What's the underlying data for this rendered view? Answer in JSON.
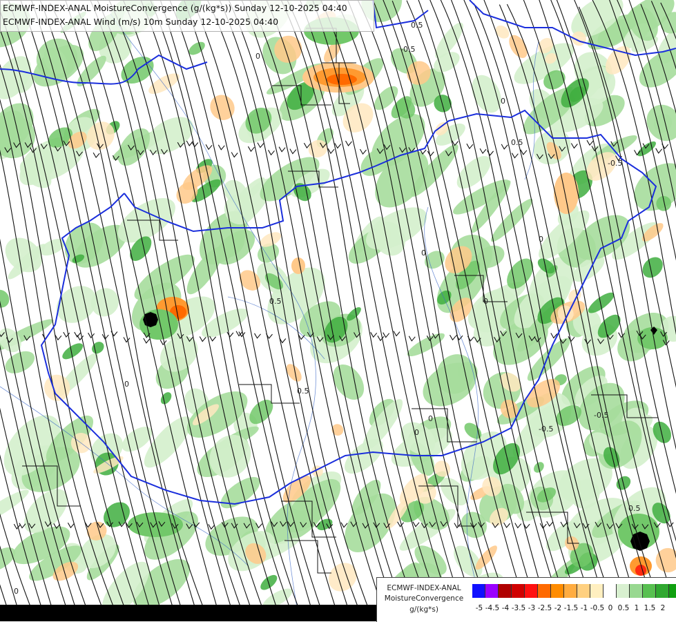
{
  "map": {
    "title_line1": "ECMWF-INDEX-ANAL MoistureConvergence (g/(kg*s)) Sunday 12-10-2025 04:40",
    "title_line2": "ECMWF-INDEX-ANAL Wind (m/s) 10m Sunday 12-10-2025 04:40",
    "contour_labels": [
      "0",
      "-0.5",
      "0.5",
      "0",
      "0",
      "0.5",
      "-0.5",
      "0",
      "0.5",
      "0",
      "-0.5",
      "0",
      "0.5",
      "0",
      "-0.5",
      "0",
      "0",
      "0.5",
      "0"
    ],
    "layers": [
      "moisture-convergence-fill",
      "wind-streamlines",
      "country-borders",
      "rivers"
    ]
  },
  "legend": {
    "title_line1": "ECMWF-INDEX-ANAL",
    "title_line2": "MoistureConvergence",
    "title_line3": "g/(kg*s)",
    "colors": [
      "#1010ff",
      "#9b00ff",
      "#b00000",
      "#d00000",
      "#ff1010",
      "#ff6a00",
      "#ff8c00",
      "#ffac40",
      "#ffd080",
      "#ffefc0",
      "#ffffff",
      "#d8f0d0",
      "#98d890",
      "#58c050",
      "#30a830",
      "#10a010"
    ],
    "ticks": [
      "-5",
      "-4.5",
      "-4",
      "-3.5",
      "-3",
      "-2.5",
      "-2",
      "-1.5",
      "-1",
      "-0.5",
      "0",
      "0.5",
      "1",
      "1.5",
      "2"
    ]
  }
}
